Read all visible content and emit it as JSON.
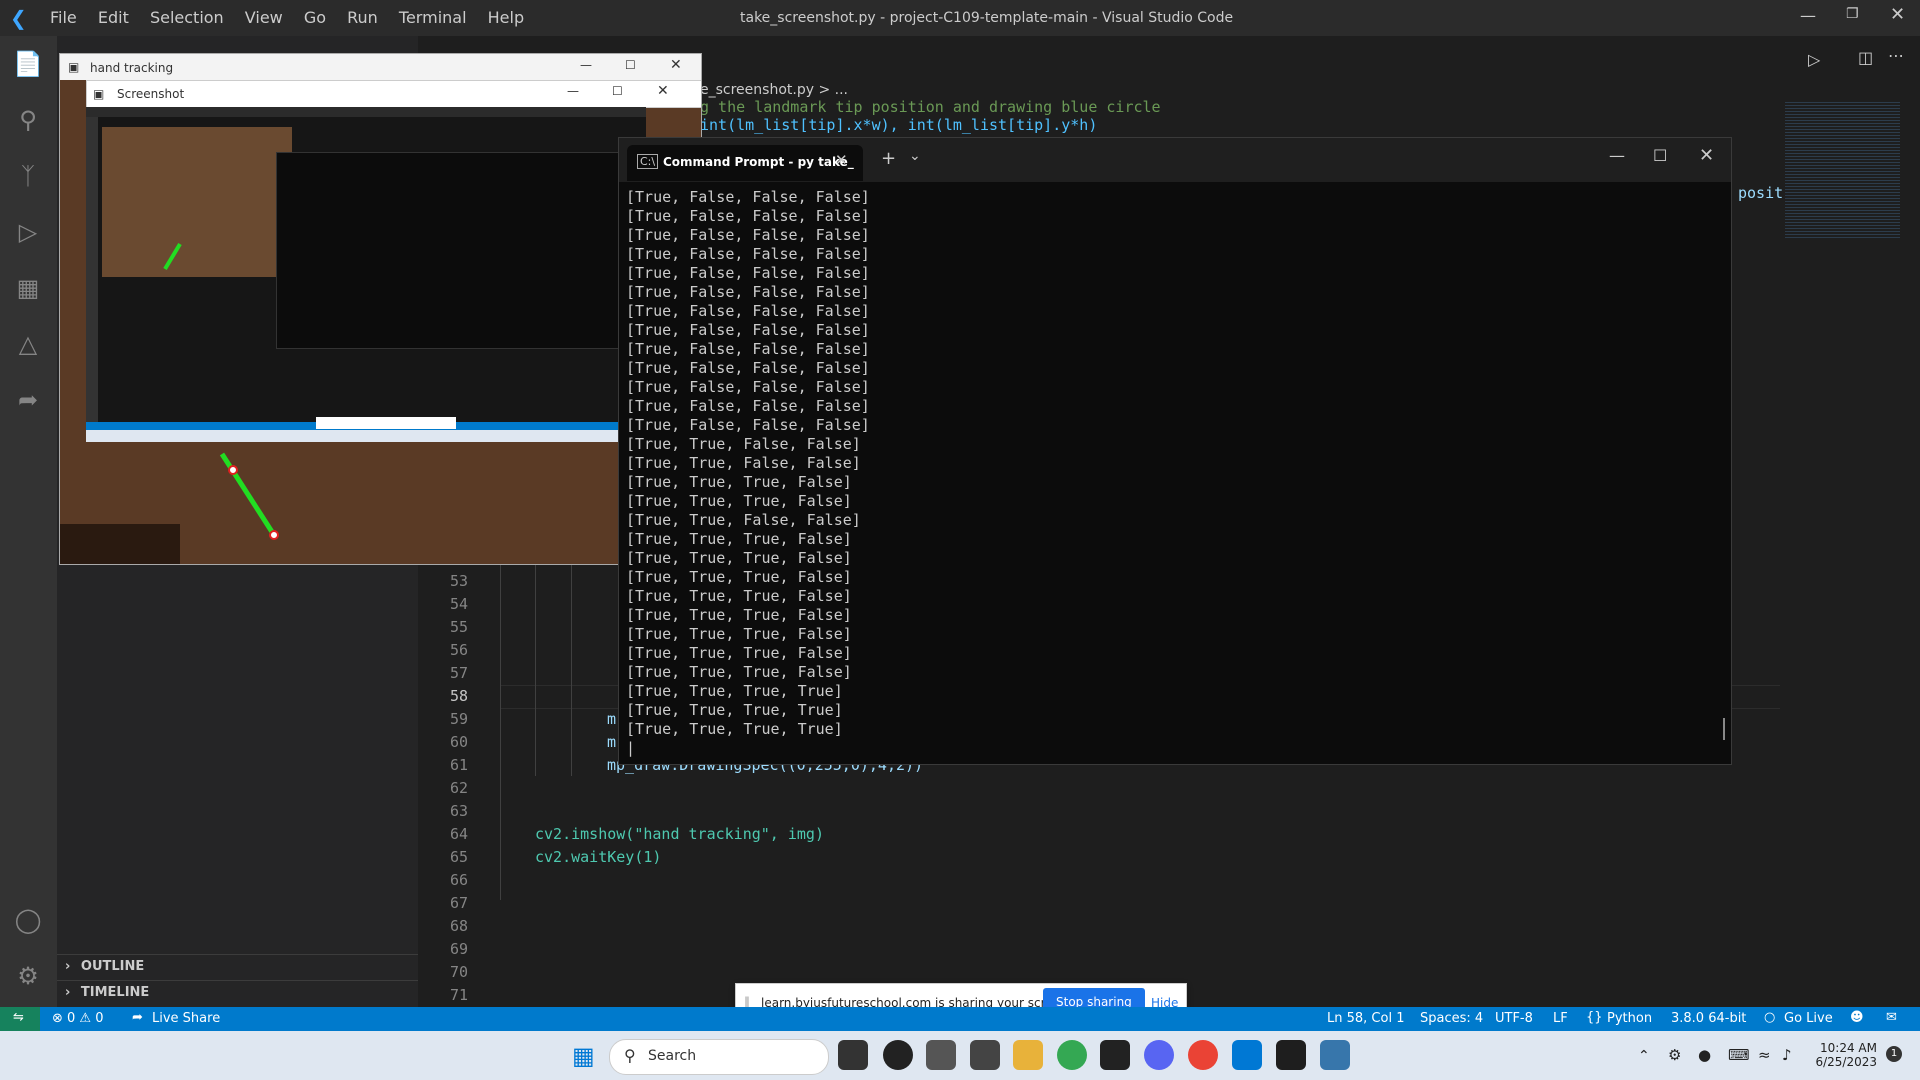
{
  "titlebar": {
    "menu": [
      "File",
      "Edit",
      "Selection",
      "View",
      "Go",
      "Run",
      "Terminal",
      "Help"
    ],
    "title": "take_screenshot.py - project-C109-template-main - Visual Studio Code"
  },
  "editor": {
    "breadcrumb": "e_screenshot.py > ...",
    "top_comment": "g the landmark tip position and drawing blue circle",
    "top_line": "int(lm_list[tip].x*w), int(lm_list[tip].y*h)",
    "side_fragment": "posit",
    "line_numbers": [
      "53",
      "54",
      "55",
      "56",
      "57",
      "58",
      "59",
      "60",
      "61",
      "62",
      "63",
      "64",
      "65",
      "66",
      "67",
      "68",
      "69",
      "70",
      "71"
    ],
    "line_59": "m",
    "line_60": "m",
    "line_61": "mp_draw.DrawingSpec((0,255,0),4,2))",
    "line_64": "cv2.imshow(\"hand tracking\", img)",
    "line_65": "cv2.waitKey(1)"
  },
  "sidebar": {
    "outline": "OUTLINE",
    "timeline": "TIMELINE"
  },
  "cmd": {
    "tab_title": "Command Prompt - py  take_",
    "output": [
      "[True, False, False, False]",
      "[True, False, False, False]",
      "[True, False, False, False]",
      "[True, False, False, False]",
      "[True, False, False, False]",
      "[True, False, False, False]",
      "[True, False, False, False]",
      "[True, False, False, False]",
      "[True, False, False, False]",
      "[True, False, False, False]",
      "[True, False, False, False]",
      "[True, False, False, False]",
      "[True, False, False, False]",
      "[True, True, False, False]",
      "[True, True, False, False]",
      "[True, True, True, False]",
      "[True, True, True, False]",
      "[True, True, False, False]",
      "[True, True, True, False]",
      "[True, True, True, False]",
      "[True, True, True, False]",
      "[True, True, True, False]",
      "[True, True, True, False]",
      "[True, True, True, False]",
      "[True, True, True, False]",
      "[True, True, True, False]",
      "[True, True, True, True]",
      "[True, True, True, True]",
      "[True, True, True, True]"
    ]
  },
  "hand_window": {
    "title": "hand tracking",
    "inner_title": "Screenshot"
  },
  "share_bar": {
    "text": "learn.byjusfutureschool.com is sharing your screen.",
    "stop": "Stop sharing",
    "hide": "Hide"
  },
  "statusbar": {
    "problems": "⊗ 0 ⚠ 0",
    "live_share": "Live Share",
    "position": "Ln 58, Col 1",
    "spaces": "Spaces: 4",
    "encoding": "UTF-8",
    "eol": "LF",
    "language": "Python",
    "interpreter": "3.8.0 64-bit",
    "go_live": "Go Live"
  },
  "taskbar": {
    "search": "Search",
    "time": "10:24 AM",
    "date": "6/25/2023"
  },
  "colors": {
    "accent": "#007acc",
    "terminal_bg": "#0c0c0c"
  }
}
